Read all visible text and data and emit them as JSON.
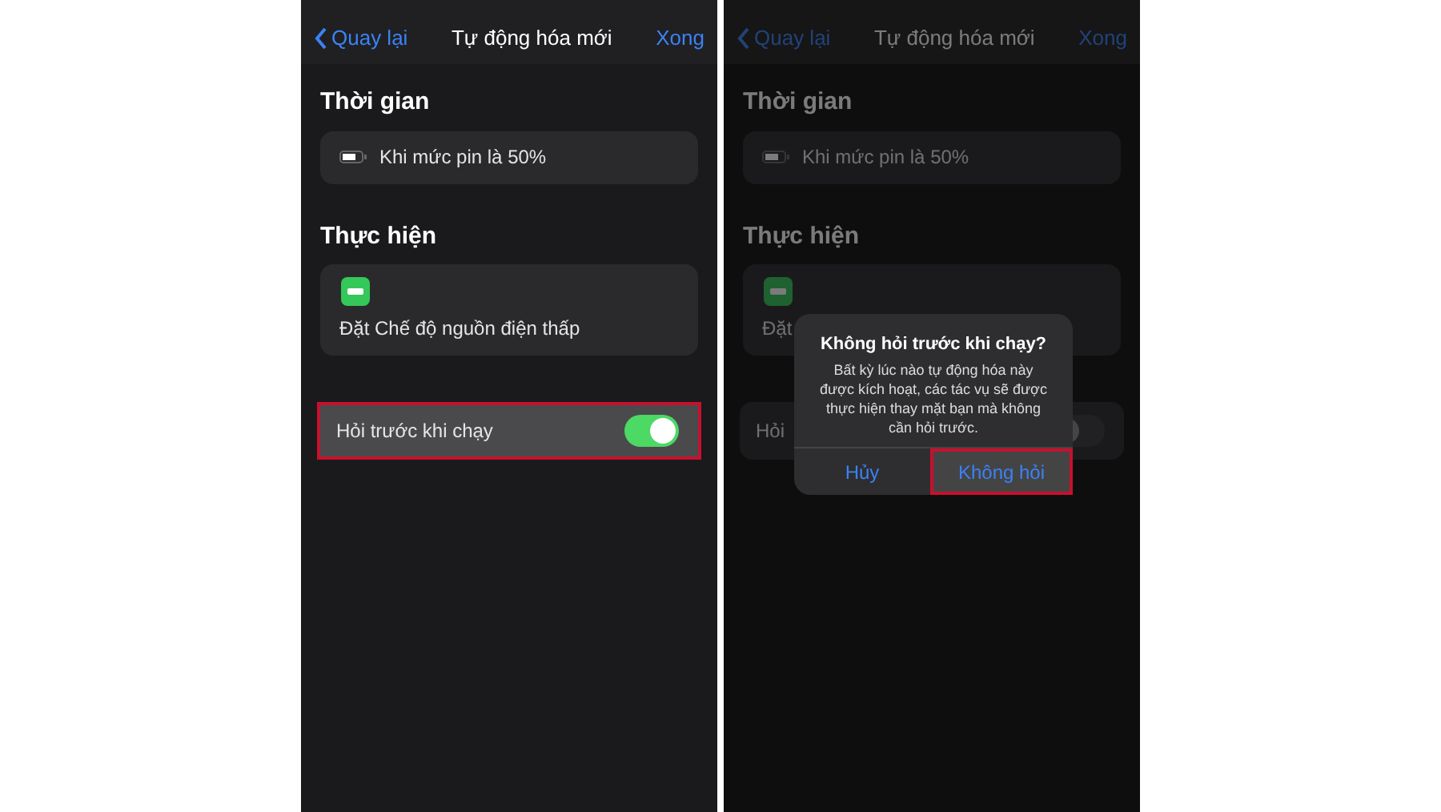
{
  "screens": [
    {
      "nav": {
        "back": "Quay lại",
        "title": "Tự động hóa mới",
        "done": "Xong"
      },
      "trigger_section": "Thời gian",
      "trigger": "Khi mức pin là 50%",
      "action_section": "Thực hiện",
      "action": "Đặt Chế độ nguồn điện thấp",
      "ask_row": {
        "label": "Hỏi trước khi chạy",
        "on": true,
        "highlighted": true
      },
      "dimmed": false
    },
    {
      "nav": {
        "back": "Quay lại",
        "title": "Tự động hóa mới",
        "done": "Xong"
      },
      "trigger_section": "Thời gian",
      "trigger": "Khi mức pin là 50%",
      "action_section": "Thực hiện",
      "action": "Đặt",
      "ask_row": {
        "label": "Hỏi",
        "on": false,
        "highlighted": false
      },
      "dimmed": true,
      "dialog": {
        "title": "Không hỏi trước khi chạy?",
        "message": "Bất kỳ lúc nào tự động hóa này được kích hoạt, các tác vụ sẽ được thực hiện thay mặt bạn mà không cần hỏi trước.",
        "buttons": [
          {
            "label": "Hủy",
            "highlighted": false
          },
          {
            "label": "Không hỏi",
            "highlighted": true
          }
        ]
      }
    }
  ]
}
